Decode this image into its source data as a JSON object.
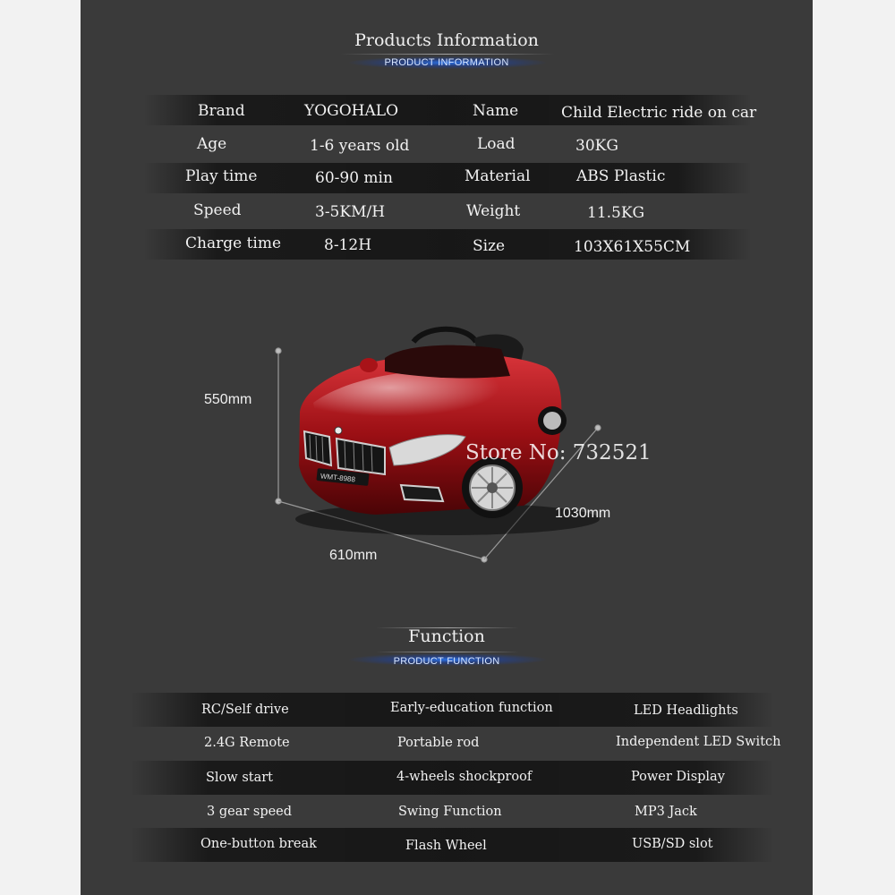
{
  "products_information": {
    "title": "Products Information",
    "subtitle": "PRODUCT INFORMATION",
    "rows": [
      {
        "label1": "Brand",
        "value1": "YOGOHALO",
        "label2": "Name",
        "value2": "Child Electric ride on car"
      },
      {
        "label1": "Age",
        "value1": "1-6 years old",
        "label2": "Load",
        "value2": "30KG"
      },
      {
        "label1": "Play time",
        "value1": "60-90 min",
        "label2": "Material",
        "value2": "ABS Plastic"
      },
      {
        "label1": "Speed",
        "value1": "3-5KM/H",
        "label2": "Weight",
        "value2": "11.5KG"
      },
      {
        "label1": "Charge time",
        "value1": "8-12H",
        "label2": "Size",
        "value2": "103X61X55CM"
      }
    ]
  },
  "product_image": {
    "dim_height": "550mm",
    "dim_width": "610mm",
    "dim_length": "1030mm",
    "plate_text": "WMT-8988",
    "watermark": "Store No: 732521",
    "car_color": "#9b0f14"
  },
  "function": {
    "title": "Function",
    "subtitle": "PRODUCT FUNCTION",
    "rows": [
      [
        "RC/Self drive",
        "Early-education function",
        "LED Headlights"
      ],
      [
        "2.4G Remote",
        "Portable rod",
        "Independent LED Switch"
      ],
      [
        "Slow start",
        "4-wheels shockproof",
        "Power Display"
      ],
      [
        "3 gear speed",
        "Swing Function",
        "MP3 Jack"
      ],
      [
        "One-button break",
        "Flash Wheel",
        "USB/SD slot"
      ]
    ]
  },
  "colors": {
    "panel": "#3a3a3a",
    "accent_glow": "#2878ff",
    "text": "#f2f2f2"
  }
}
